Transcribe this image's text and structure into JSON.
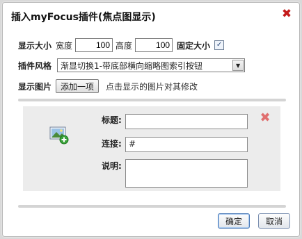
{
  "dialog": {
    "title": "插入myFocus插件(焦点图显示)"
  },
  "size": {
    "label": "显示大小",
    "width_label": "宽度",
    "width_value": "100",
    "height_label": "高度",
    "height_value": "100",
    "fixed_label": "固定大小",
    "fixed_checked": true
  },
  "style": {
    "label": "插件风格",
    "selected": "渐显切换1-带底部横向缩略图索引按钮"
  },
  "images": {
    "label": "显示图片",
    "add_button": "添加一项",
    "hint": "点击显示的图片对其修改"
  },
  "item": {
    "title_label": "标题:",
    "title_value": "",
    "link_label": "连接:",
    "link_value": "#",
    "desc_label": "说明:",
    "desc_value": ""
  },
  "footer": {
    "ok": "确定",
    "cancel": "取消"
  }
}
